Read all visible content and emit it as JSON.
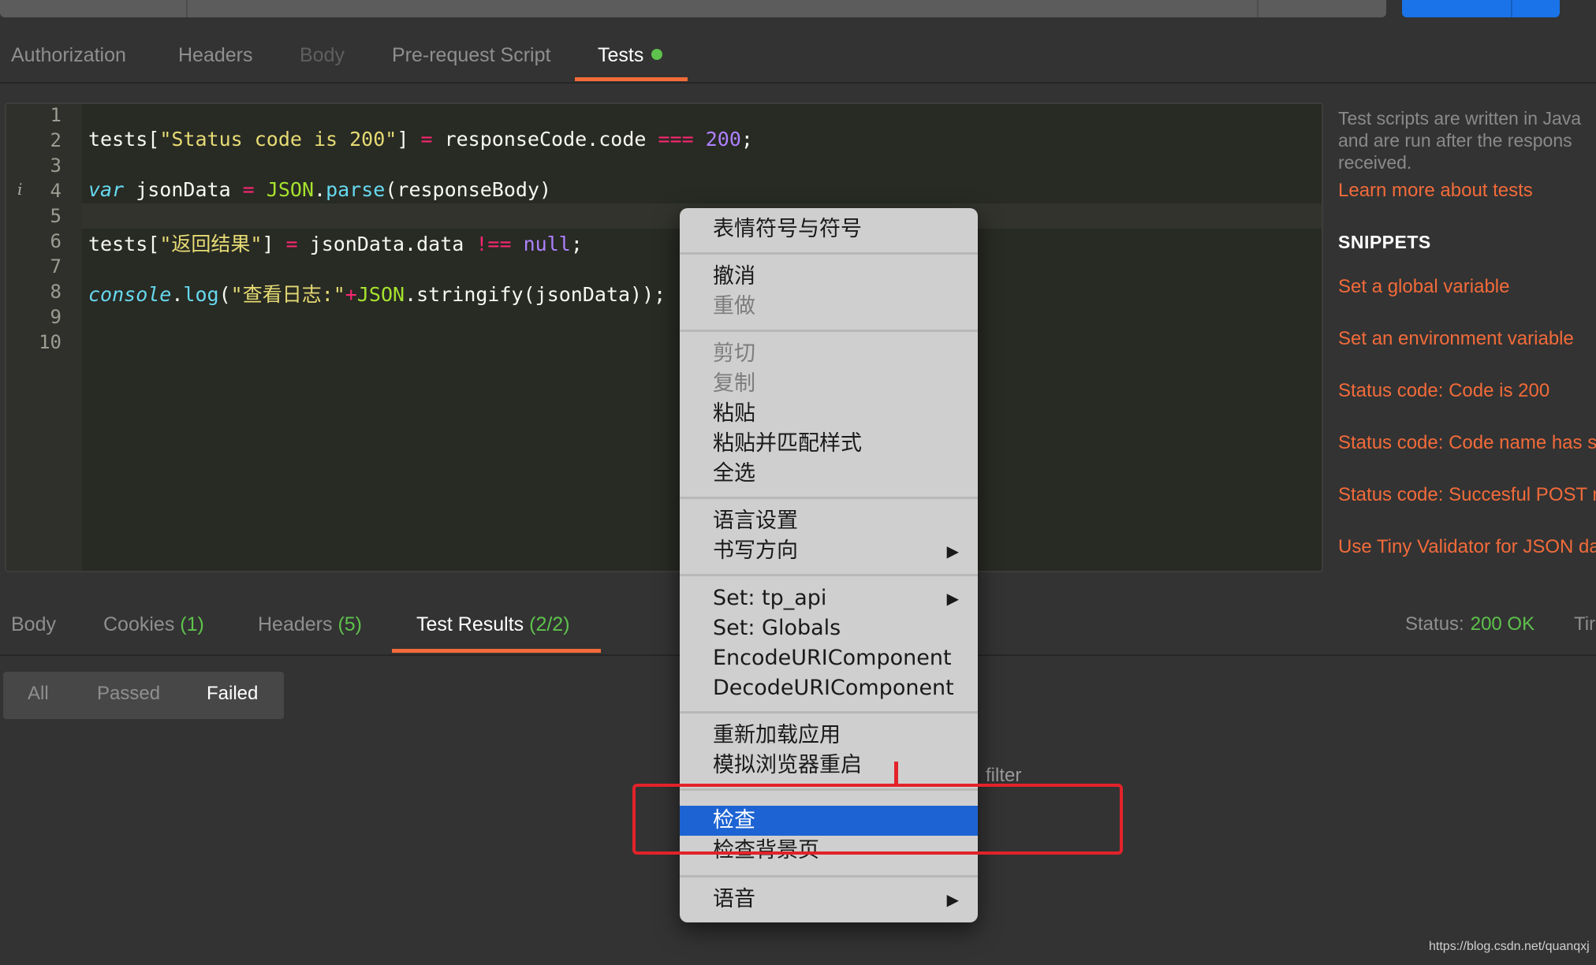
{
  "request_tabs": [
    {
      "label": "Authorization"
    },
    {
      "label": "Headers"
    },
    {
      "label": "Body"
    },
    {
      "label": "Pre-request Script"
    },
    {
      "label": "Tests"
    }
  ],
  "editor": {
    "line_numbers": [
      "1",
      "2",
      "3",
      "4",
      "5",
      "6",
      "7",
      "8",
      "9",
      "10"
    ],
    "line2": {
      "t1": "tests[",
      "s1": "\"Status code is 200\"",
      "t2": "] ",
      "o1": "=",
      "t3": " responseCode.code ",
      "o2": "===",
      "t4": " ",
      "n1": "200",
      "t5": ";"
    },
    "line4": {
      "k1": "var",
      "t1": " jsonData ",
      "o1": "=",
      "t2": " ",
      "f1": "JSON",
      "t3": ".",
      "f2": "parse",
      "t4": "(responseBody)"
    },
    "line6": {
      "t1": "tests[",
      "s1": "\"返回结果\"",
      "t2": "] ",
      "o1": "=",
      "t3": " jsonData.data ",
      "o2": "!==",
      "t4": " ",
      "n1": "null",
      "t5": ";"
    },
    "line8": {
      "k1": "console",
      "t1": ".",
      "f1": "log",
      "t2": "(",
      "s1": "\"查看日志:\"",
      "o1": "+",
      "f2": "JSON",
      "t3": ".stringify(jsonData));"
    }
  },
  "sidebar": {
    "desc_lines": [
      "Test scripts are written in Java",
      "and are run after the respons",
      "received."
    ],
    "learn_link": "Learn more about tests",
    "snippets_heading": "SNIPPETS",
    "snippets": [
      "Set a global variable",
      "Set an environment variable",
      "Status code: Code is 200",
      "Status code: Code name has s",
      "Status code: Succesful POST r",
      "Use Tiny Validator for JSON da"
    ]
  },
  "response_tabs": {
    "body": "Body",
    "cookies": "Cookies",
    "cookies_count": "(1)",
    "headers": "Headers",
    "headers_count": "(5)",
    "test_results": "Test Results",
    "test_results_count": "(2/2)",
    "status_label": "Status:",
    "status_value": "200 OK",
    "time_cut": "Tir"
  },
  "filter": {
    "all": "All",
    "passed": "Passed",
    "failed": "Failed",
    "filter_text": "filter"
  },
  "context_menu": {
    "emoji": "表情符号与符号",
    "undo": "撤消",
    "redo": "重做",
    "cut": "剪切",
    "copy": "复制",
    "paste": "粘贴",
    "paste_match": "粘贴并匹配样式",
    "select_all": "全选",
    "language": "语言设置",
    "writing_dir": "书写方向",
    "set_tp_api": "Set: tp_api",
    "set_globals": "Set: Globals",
    "encode": "EncodeURIComponent",
    "decode": "DecodeURIComponent",
    "reload": "重新加载应用",
    "sim_restart": "模拟浏览器重启",
    "inspect": "检查",
    "inspect_bg": "检查背景页",
    "speech": "语音",
    "arrow": "▶"
  },
  "watermark": "https://blog.csdn.net/quanqxj",
  "colors": {
    "accent": "#f26b3a",
    "success": "#5ec24c",
    "highlight": "#1d63d3",
    "annotation": "#e3222a"
  }
}
